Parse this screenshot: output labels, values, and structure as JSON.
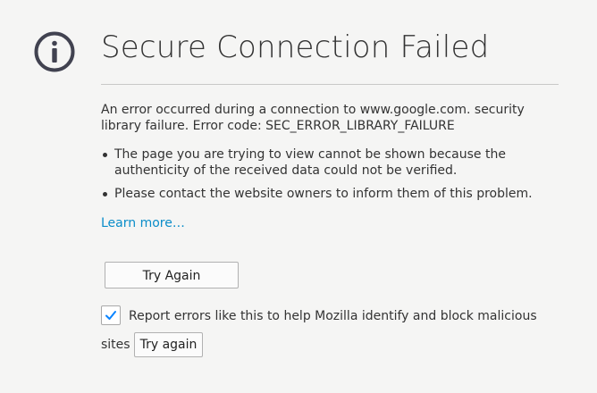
{
  "error_page": {
    "icon": "info-icon",
    "title": "Secure Connection Failed",
    "description": "An error occurred during a connection to www.google.com. security library failure. Error code: SEC_ERROR_LIBRARY_FAILURE",
    "bullets": [
      "The page you are trying to view cannot be shown because the authenticity of the received data could not be verified.",
      "Please contact the website owners to inform them of this problem."
    ],
    "learn_more": "Learn more…",
    "try_again_label": "Try Again",
    "report": {
      "checked": true,
      "label_part1": "Report errors like this to help Mozilla identify and block malicious",
      "label_part2": "sites",
      "button_label": "Try again"
    }
  },
  "colors": {
    "background": "#f5f5f4",
    "link": "#0a8dc9",
    "icon": "#414250",
    "checkmark": "#0a84ff"
  }
}
